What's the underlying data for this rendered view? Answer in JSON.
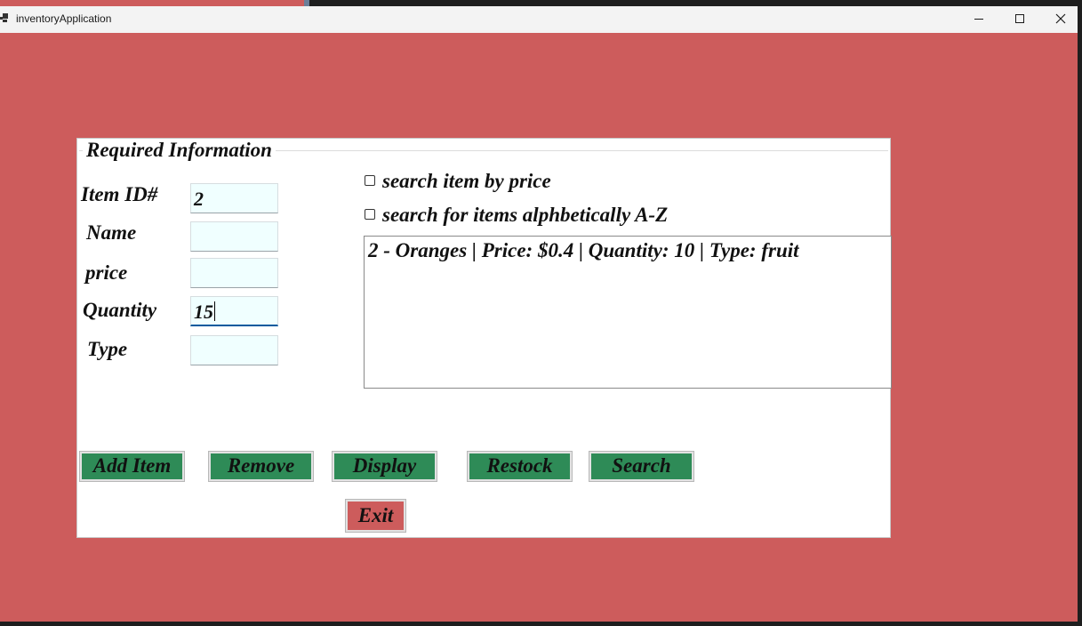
{
  "window": {
    "title": "inventoryApplication",
    "background_color": "#cd5c5c",
    "controls": {
      "minimize": "minimize-icon",
      "maximize": "maximize-icon",
      "close": "close-icon"
    }
  },
  "form": {
    "group_title": "Required Information",
    "fields": [
      {
        "label": "Item ID#",
        "value": "2"
      },
      {
        "label": "Name",
        "value": ""
      },
      {
        "label": "price",
        "value": ""
      },
      {
        "label": "Quantity",
        "value": "15"
      },
      {
        "label": "Type",
        "value": ""
      }
    ],
    "field_background": "#f0ffff",
    "checkboxes": [
      {
        "label": "search item by price",
        "checked": false
      },
      {
        "label": "search for items alphbetically A-Z",
        "checked": false
      }
    ],
    "output_lines": [
      "2 - Oranges | Price: $0.4 | Quantity: 10 | Type: fruit"
    ],
    "buttons": {
      "add": "Add Item",
      "remove": "Remove",
      "display": "Display",
      "restock": "Restock",
      "search": "Search",
      "exit": "Exit"
    },
    "button_color": "#2e8b57",
    "exit_button_color": "#cd5c5c"
  }
}
